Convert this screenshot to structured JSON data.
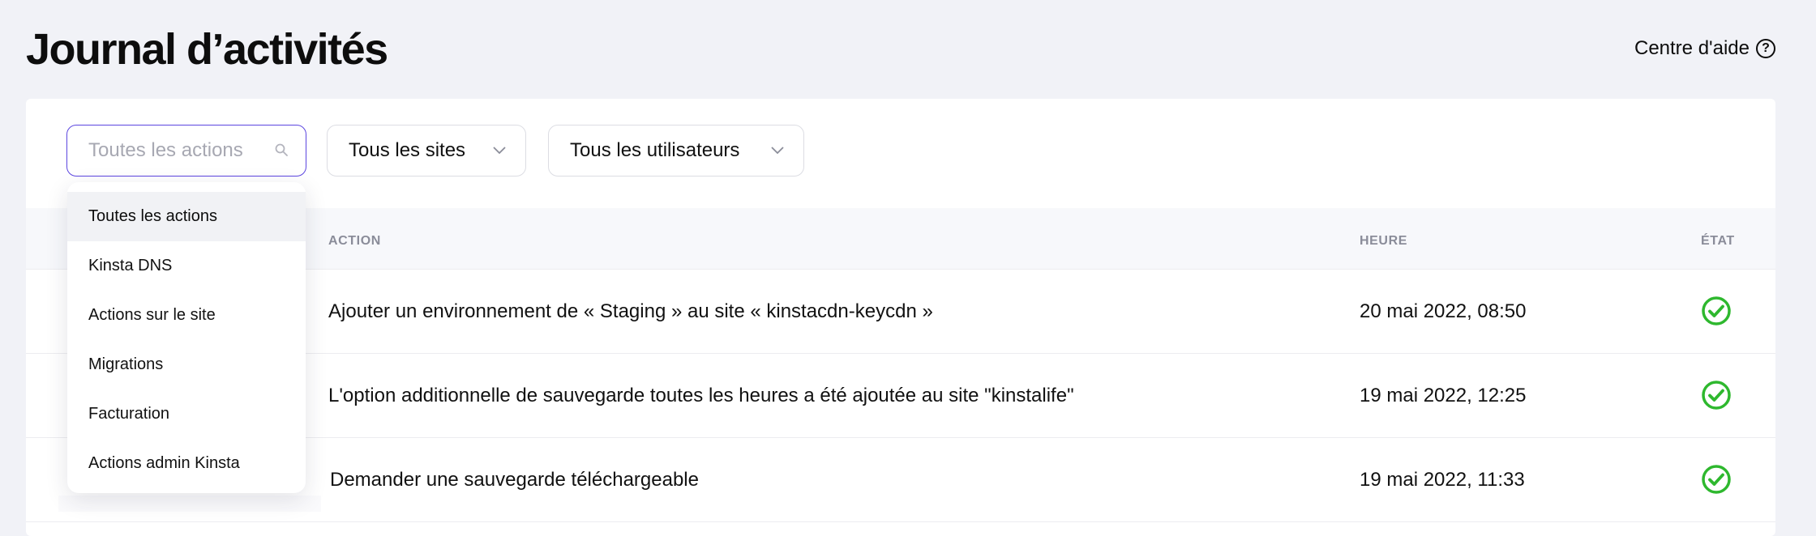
{
  "header": {
    "title": "Journal d’activités",
    "help_label": "Centre d'aide",
    "help_icon": "question-circle-icon"
  },
  "filters": {
    "actions_placeholder": "Toutes les actions",
    "sites_label": "Tous les sites",
    "users_label": "Tous les utilisateurs"
  },
  "table": {
    "columns": {
      "action": "ACTION",
      "time": "HEURE",
      "status": "ÉTAT"
    },
    "rows": [
      {
        "action": "Ajouter un environnement de « Staging » au site « kinstacdn-keycdn »",
        "time": "20 mai 2022, 08:50",
        "status": "success"
      },
      {
        "action": "L'option additionnelle de sauvegarde toutes les heures a été ajoutée au site \"kinstalife\"",
        "time": "19 mai 2022, 12:25",
        "status": "success"
      },
      {
        "action": "Demander une sauvegarde téléchargeable",
        "time": "19 mai 2022, 11:33",
        "status": "success"
      }
    ]
  },
  "dropdown": {
    "items": [
      "Toutes les actions",
      "Kinsta DNS",
      "Actions sur le site",
      "Migrations",
      "Facturation",
      "Actions admin Kinsta"
    ],
    "selected_index": 0
  },
  "colors": {
    "accent": "#5c46e0",
    "success": "#2eb82e",
    "background": "#f1f2f7"
  }
}
